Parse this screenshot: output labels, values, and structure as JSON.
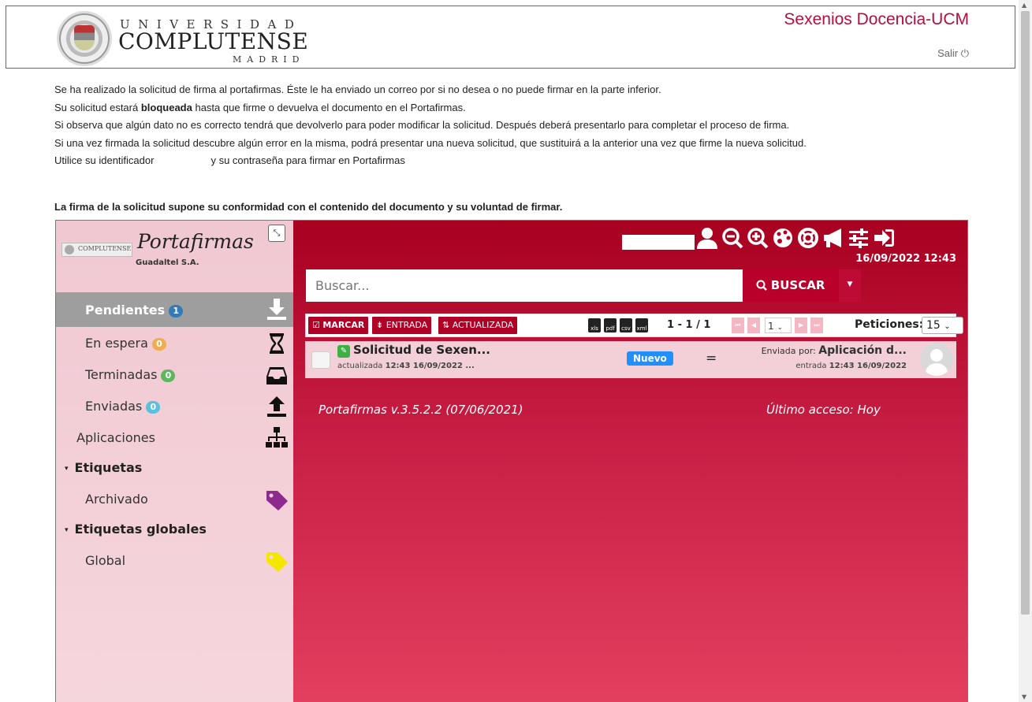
{
  "header": {
    "logo_line1": "UNIVERSIDAD",
    "logo_line2": "COMPLUTENSE",
    "logo_line3": "MADRID",
    "site_title": "Sexenios Docencia-UCM",
    "logout_label": "Salir ⏻"
  },
  "notices": {
    "line1": "Se ha realizado la solicitud de firma al portafirmas. Éste le ha enviado un correo por si no desea o no puede firmar en la parte inferior.",
    "line2_pre": "Su solicitud estará ",
    "line2_bold": "bloqueada",
    "line2_post": " hasta que firme o devuelva el documento en el Portafirmas.",
    "line3": "Si observa que algún dato no es correcto tendrá que devolverlo para poder modificar la solicitud. Después deberá presentarlo para completar el proceso de firma.",
    "line4": "Si una vez firmada la solicitud descubre algún error en la misma, podrá presentar una nueva solicitud, que sustituirá a la anterior una vez que firme la nueva solicitud.",
    "line5_pre": "Utilice su identificador",
    "line5_post": "y su contraseña para firmar en Portafirmas",
    "conformity": "La firma de la solicitud supone su conformidad con el contenido del documento y su voluntad de firmar."
  },
  "portafirmas": {
    "mini_logo": "COMPLUTENSE",
    "brand": "Portafirmas",
    "company": "Guadaltel S.A.",
    "collapse_icon": "⤡",
    "nav": {
      "pending": {
        "label": "Pendientes",
        "count": "1"
      },
      "waiting": {
        "label": "En espera",
        "count": "0"
      },
      "finished": {
        "label": "Terminadas",
        "count": "0"
      },
      "sent": {
        "label": "Enviadas",
        "count": "0"
      },
      "applications": {
        "label": "Aplicaciones"
      },
      "tags_section": {
        "label": "Etiquetas"
      },
      "archived": {
        "label": "Archivado"
      },
      "global_tags_section": {
        "label": "Etiquetas globales"
      },
      "global": {
        "label": "Global"
      }
    },
    "icons": [
      "user-icon",
      "zoom-out-icon",
      "zoom-in-icon",
      "palette-icon",
      "help-icon",
      "announcement-icon",
      "settings-icon",
      "logout-icon"
    ],
    "datetime": "16/09/2022 12:43",
    "search": {
      "placeholder": "Buscar...",
      "button_label": "BUSCAR"
    },
    "toolbar": {
      "mark_label": "MARCAR",
      "entry_label": "ENTRADA",
      "updated_label": "ACTUALIZADA",
      "export_formats": [
        "xls",
        "pdf",
        "csv",
        "xml"
      ],
      "range": "1 - 1 / 1",
      "page": "1",
      "per_page_label": "Peticiones:",
      "per_page": "15"
    },
    "requests": [
      {
        "subject": "Solicitud de Sexen...",
        "updated_prefix": "actualizada",
        "updated": "12:43 16/09/2022 ...",
        "status": "Nuevo",
        "priority": "=",
        "sent_by_prefix": "Enviada por:",
        "sent_by": "Aplicación d...",
        "entry_prefix": "entrada",
        "entry": "12:43 16/09/2022"
      }
    ],
    "footer": {
      "version": "Portafirmas v.3.5.2.2 (07/06/2021)",
      "last_access": "Último acceso: Hoy"
    }
  }
}
